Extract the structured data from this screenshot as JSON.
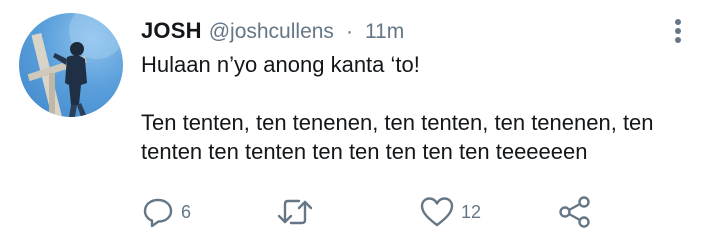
{
  "tweet": {
    "author": {
      "display_name": "JOSH",
      "handle": "@joshcullens",
      "avatar": "avatar"
    },
    "separator": "·",
    "timestamp": "11m",
    "body": {
      "line1": "Hulaan n’yo anong kanta ‘to!",
      "line2": "Ten tenten, ten tenenen, ten tenten, ten tenenen, ten tenten ten tenten ten ten ten ten ten teeeeeen"
    },
    "actions": {
      "reply": {
        "icon": "reply-icon",
        "count": "6"
      },
      "retweet": {
        "icon": "retweet-icon",
        "count": ""
      },
      "like": {
        "icon": "heart-icon",
        "count": "12"
      },
      "share": {
        "icon": "share-icon"
      }
    },
    "more_icon": "more-vertical-icon",
    "colors": {
      "text": "#14171a",
      "muted": "#657786",
      "icon": "#657786",
      "avatar_sky": "#5ba0dc"
    }
  }
}
